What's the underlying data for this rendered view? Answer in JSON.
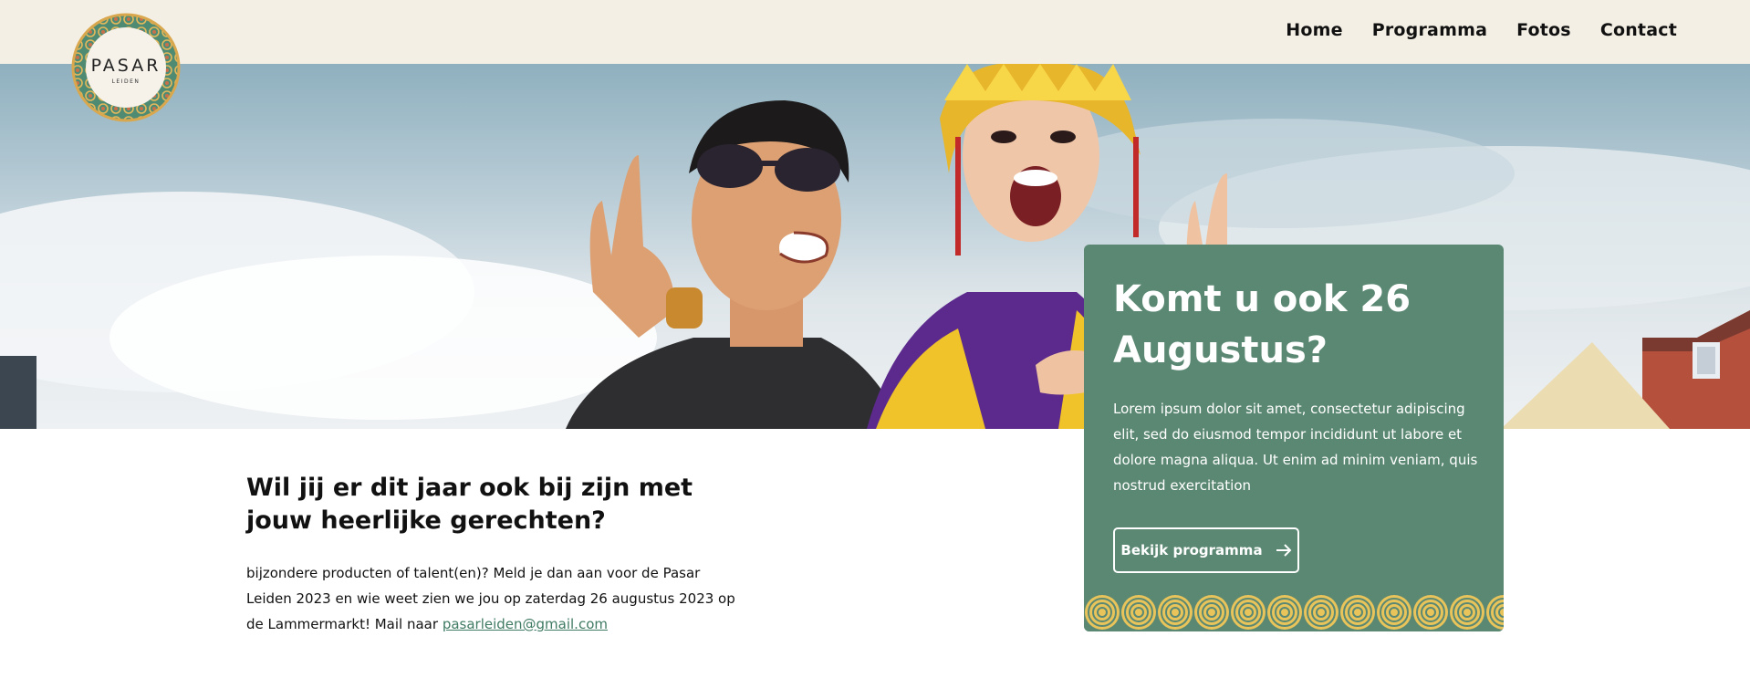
{
  "nav": {
    "items": [
      {
        "label": "Home"
      },
      {
        "label": "Programma"
      },
      {
        "label": "Fotos"
      },
      {
        "label": "Contact"
      }
    ]
  },
  "logo": {
    "name": "PASAR",
    "sub": "LEIDEN",
    "icon": "pasar-leiden-logo-icon"
  },
  "hero": {
    "image": "hero-photo-dancers"
  },
  "card": {
    "title": "Komt u ook 26 Augustus?",
    "text": "Lorem ipsum dolor sit amet, consectetur adipiscing elit, sed do eiusmod tempor incididunt ut labore et dolore magna aliqua. Ut enim ad minim veniam, quis nostrud exercitation",
    "button_label": "Bekijk programma",
    "button_icon": "arrow-right-icon"
  },
  "intro": {
    "title": "Wil jij er dit jaar ook bij zijn met jouw heerlijke gerechten?",
    "text": "bijzondere producten of talent(en)? Meld je dan aan voor de Pasar Leiden 2023 en wie weet zien we jou op zaterdag 26 augustus 2023 op de Lammermarkt! Mail naar ",
    "email": "pasarleiden@gmail.com"
  },
  "colors": {
    "header_bg": "#f4efe4",
    "card_bg": "#5b8873",
    "accent_gold": "#e8c45a",
    "link": "#3f7a62"
  }
}
